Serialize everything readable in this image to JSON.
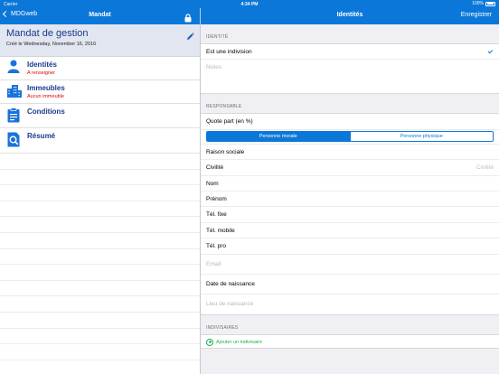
{
  "status": {
    "carrier": "Carrier",
    "time": "4:34 PM",
    "battery": "100%"
  },
  "left_nav": {
    "back_label": "MDGweb",
    "title": "Mandat"
  },
  "right_nav": {
    "title": "Identités",
    "save_label": "Enregistrer"
  },
  "mandat": {
    "title": "Mandat de gestion",
    "created": "Créé le Wednesday, November 16, 2016"
  },
  "menu": [
    {
      "label": "Identités",
      "sub": "A renseigner",
      "icon": "person-icon"
    },
    {
      "label": "Immeubles",
      "sub": "Aucun immeuble",
      "icon": "buildings-icon"
    },
    {
      "label": "Conditions",
      "sub": "",
      "icon": "clipboard-icon"
    },
    {
      "label": "Résumé",
      "sub": "",
      "icon": "magnifier-document-icon"
    }
  ],
  "identite": {
    "header": "IDENTITÉ",
    "indivision_label": "Est une indivision",
    "notes_placeholder": "Notes"
  },
  "responsable": {
    "header": "RESPONSABLE",
    "quote_part": "Quote part (en %)",
    "segment": {
      "left": "Personne morale",
      "right": "Personne physique"
    },
    "raison_sociale": "Raison sociale",
    "civilite": "Civilité",
    "civilite_value": "Civilité",
    "nom": "Nom",
    "prenom": "Prénom",
    "tel_fixe": "Tél. fixe",
    "tel_mobile": "Tél. mobile",
    "tel_pro": "Tél. pro",
    "email_placeholder": "Email",
    "date_naissance": "Date de naissance",
    "lieu_placeholder": "Lieu de naissance"
  },
  "indivisaires": {
    "header": "INDIVISAIRES",
    "add_label": "Ajouter un indivisaire"
  },
  "colors": {
    "accent": "#0b78d9",
    "alert": "#e00000",
    "add": "#1bb24a",
    "menu_text": "#1a3a8a"
  }
}
